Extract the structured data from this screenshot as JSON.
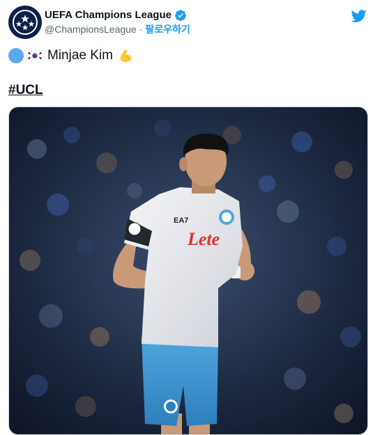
{
  "account": {
    "display_name": "UEFA Champions League",
    "handle": "@ChampionsLeague",
    "separator": "·",
    "follow_label": "팔로우하기",
    "verified": true,
    "brand_color": "#1d9bf0"
  },
  "icons": {
    "avatar": "champions-league-starball-icon",
    "verified": "verified-badge-icon",
    "platform": "twitter-bird-icon",
    "emoji_1": "blue-circle-icon",
    "emoji_2": "south-korea-flag-icon",
    "emoji_3": "flexed-biceps-icon"
  },
  "tweet": {
    "player_name": "Minjae Kim",
    "hashtag": "#UCL"
  },
  "media": {
    "kit_sponsor": "EA7",
    "shirt_sponsor": "Lete"
  }
}
